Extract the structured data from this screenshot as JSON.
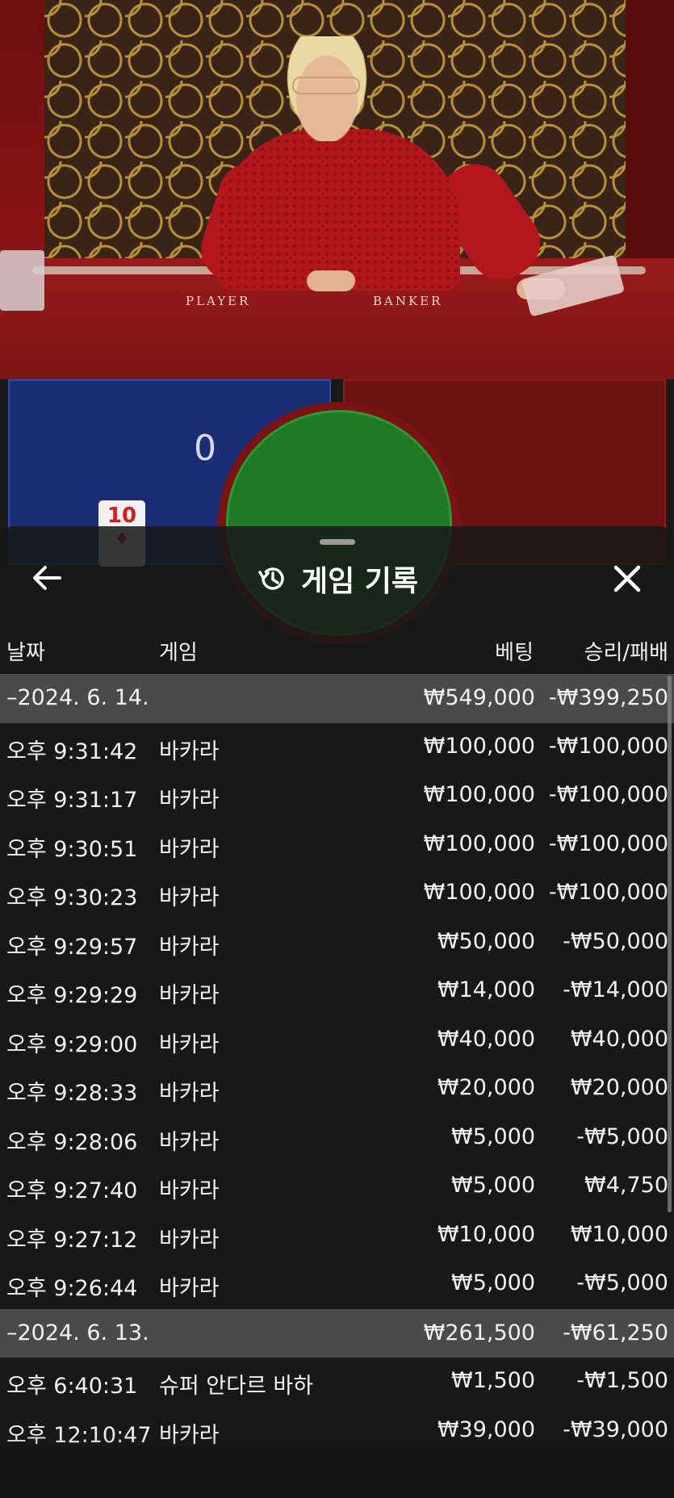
{
  "background": {
    "table_labels": [
      "PLAYER",
      "BANKER"
    ],
    "player_score": "0",
    "player_card": "10"
  },
  "sheet": {
    "title": "게임 기록",
    "back_icon": "arrow-left-icon",
    "history_icon": "history-icon",
    "close_icon": "close-icon",
    "columns": {
      "date": "날짜",
      "game": "게임",
      "bet": "베팅",
      "result": "승리/패배"
    },
    "rows": [
      {
        "type": "date",
        "time": "–2024. 6. 14.",
        "game": "",
        "bet": "₩549,000",
        "result": "-₩399,250"
      },
      {
        "type": "entry",
        "time": "오후 9:31:42",
        "game": "바카라",
        "bet": "₩100,000",
        "result": "-₩100,000"
      },
      {
        "type": "entry",
        "time": "오후 9:31:17",
        "game": "바카라",
        "bet": "₩100,000",
        "result": "-₩100,000"
      },
      {
        "type": "entry",
        "time": "오후 9:30:51",
        "game": "바카라",
        "bet": "₩100,000",
        "result": "-₩100,000"
      },
      {
        "type": "entry",
        "time": "오후 9:30:23",
        "game": "바카라",
        "bet": "₩100,000",
        "result": "-₩100,000"
      },
      {
        "type": "entry",
        "time": "오후 9:29:57",
        "game": "바카라",
        "bet": "₩50,000",
        "result": "-₩50,000"
      },
      {
        "type": "entry",
        "time": "오후 9:29:29",
        "game": "바카라",
        "bet": "₩14,000",
        "result": "-₩14,000"
      },
      {
        "type": "entry",
        "time": "오후 9:29:00",
        "game": "바카라",
        "bet": "₩40,000",
        "result": "₩40,000"
      },
      {
        "type": "entry",
        "time": "오후 9:28:33",
        "game": "바카라",
        "bet": "₩20,000",
        "result": "₩20,000"
      },
      {
        "type": "entry",
        "time": "오후 9:28:06",
        "game": "바카라",
        "bet": "₩5,000",
        "result": "-₩5,000"
      },
      {
        "type": "entry",
        "time": "오후 9:27:40",
        "game": "바카라",
        "bet": "₩5,000",
        "result": "₩4,750"
      },
      {
        "type": "entry",
        "time": "오후 9:27:12",
        "game": "바카라",
        "bet": "₩10,000",
        "result": "₩10,000"
      },
      {
        "type": "entry",
        "time": "오후 9:26:44",
        "game": "바카라",
        "bet": "₩5,000",
        "result": "-₩5,000"
      },
      {
        "type": "date",
        "time": "–2024. 6. 13.",
        "game": "",
        "bet": "₩261,500",
        "result": "-₩61,250"
      },
      {
        "type": "entry",
        "time": "오후 6:40:31",
        "game": "슈퍼 안다르 바하",
        "bet": "₩1,500",
        "result": "-₩1,500"
      },
      {
        "type": "entry",
        "time": "오후 12:10:47",
        "game": "바카라",
        "bet": "₩39,000",
        "result": "-₩39,000"
      }
    ]
  }
}
